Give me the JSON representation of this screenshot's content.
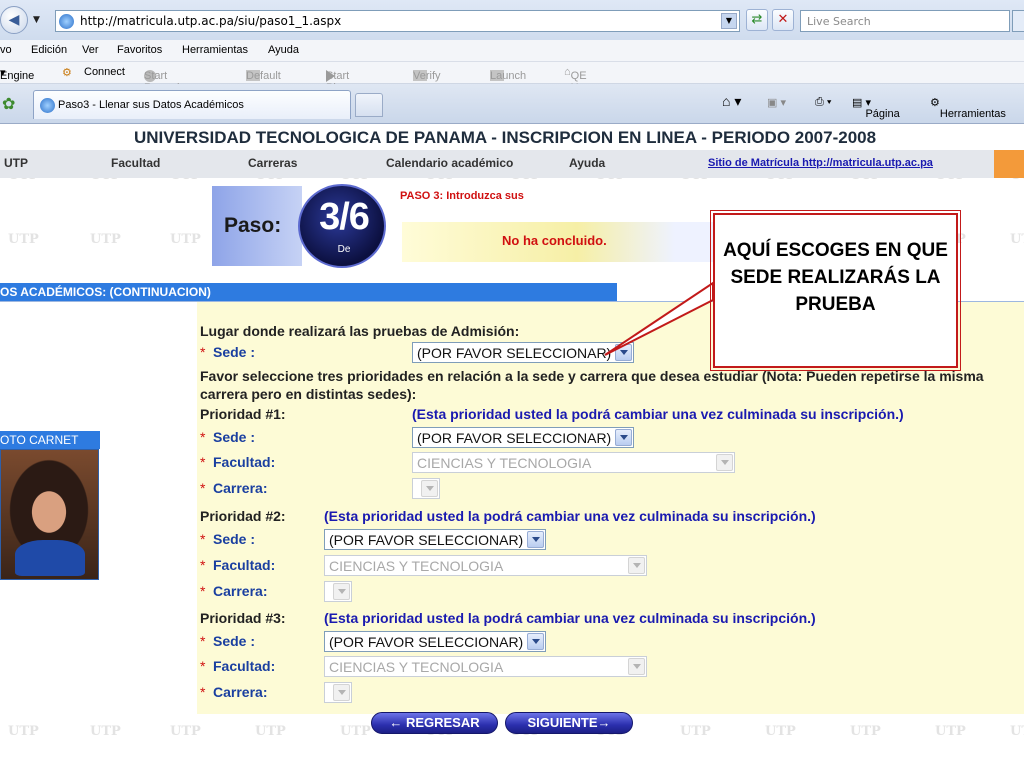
{
  "browser": {
    "url": "http://matricula.utp.ac.pa/siu/paso1_1.aspx",
    "search_placeholder": "Live Search",
    "menu": [
      "vo",
      "Edición",
      "Ver",
      "Favoritos",
      "Herramientas",
      "Ayuda"
    ],
    "command_bar": {
      "engine": "Engine",
      "connect": "Connect",
      "start_record": "Start Record",
      "default": "Default",
      "start_play": "Start Play",
      "verify": "Verify",
      "launch": "Launch",
      "qe_home": "QE Home"
    },
    "tab_title": "Paso3 - Llenar sus Datos Académicos",
    "tab_tools": {
      "pagina": "Página",
      "herramientas": "Herramientas"
    }
  },
  "site": {
    "title": "UNIVERSIDAD TECNOLOGICA DE PANAMA - INSCRIPCION EN LINEA - PERIODO 2007-2008",
    "nav": [
      "UTP",
      "Facultad",
      "Carreras",
      "Calendario académico",
      "Ayuda"
    ],
    "nav_link": "Sitio de Matrícula http://matricula.utp.ac.pa",
    "watermark": "UTP"
  },
  "step": {
    "label": "Paso:",
    "number": "3/6",
    "de": "De",
    "title": "PASO 3: Introduzca sus",
    "status": "No ha concluido."
  },
  "section": {
    "header": "OS ACADÉMICOS: (CONTINUACION)",
    "photo_header": "OTO CARNET"
  },
  "form": {
    "admission_label": "Lugar donde realizará las pruebas de Admisión:",
    "sede_label": "Sede :",
    "sede_value": "(POR FAVOR SELECCIONAR)",
    "instructions_1": "Favor seleccione tres  prioridades en relación a la sede y carrera que desea estudiar (Nota: Pueden repetirse la misma",
    "instructions_2": "carrera pero en distintas sedes):",
    "required_mark": "*",
    "facultad_label": "Facultad:",
    "carrera_label": "Carrera:",
    "priorities": [
      {
        "title": "Prioridad #1:",
        "note": "(Esta prioridad usted la podrá cambiar una vez culminada su inscripción.)",
        "sede": "(POR FAVOR SELECCIONAR)",
        "facultad": "CIENCIAS Y TECNOLOGIA",
        "carrera": ""
      },
      {
        "title": "Prioridad #2:",
        "note": "(Esta prioridad usted la podrá cambiar una vez culminada su inscripción.)",
        "sede": "(POR FAVOR SELECCIONAR)",
        "facultad": "CIENCIAS Y TECNOLOGIA",
        "carrera": ""
      },
      {
        "title": "Prioridad #3:",
        "note": "(Esta prioridad usted la podrá cambiar una vez culminada su inscripción.)",
        "sede": "(POR FAVOR SELECCIONAR)",
        "facultad": "CIENCIAS Y TECNOLOGIA",
        "carrera": ""
      }
    ]
  },
  "buttons": {
    "back": "← REGRESAR",
    "next": "SIGUIENTE→"
  },
  "callout": {
    "text": "AQUÍ ESCOGES EN QUE SEDE REALIZARÁS LA PRUEBA"
  },
  "colors": {
    "accent": "#2e7be0",
    "form_bg": "#fdfbd6",
    "alert": "#d01010",
    "callout_border": "#c21a1a"
  }
}
